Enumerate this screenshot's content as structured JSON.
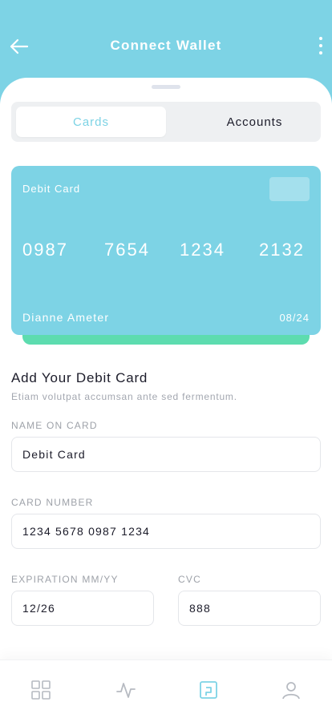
{
  "header": {
    "title": "Connect Wallet",
    "back_icon": "arrow-left-icon",
    "more_icon": "more-vertical-icon"
  },
  "segment": {
    "active_label": "Cards",
    "inactive_label": "Accounts"
  },
  "card": {
    "type_label": "Debit Card",
    "number_groups": [
      "0987",
      "7654",
      "1234",
      "2132"
    ],
    "holder": "Dianne Ameter",
    "expiry": "08/24"
  },
  "form": {
    "title": "Add Your Debit Card",
    "subtitle": "Etiam volutpat accumsan ante sed fermentum.",
    "name_label": "NAME ON CARD",
    "name_value": "Debit Card",
    "number_label": "CARD NUMBER",
    "number_value": "1234 5678 0987 1234",
    "expiry_label": "EXPIRATION MM/YY",
    "expiry_value": "12/26",
    "cvc_label": "CVC",
    "cvc_value": "888"
  },
  "tabbar": {
    "items": [
      "grid-icon",
      "activity-icon",
      "wallet-icon",
      "profile-icon"
    ],
    "active_index": 2
  },
  "colors": {
    "accent": "#7dd3e5",
    "card_bg": "#7dd3e5",
    "card_accent": "#5ddcaf",
    "text_dark": "#1c1c2a",
    "text_muted": "#a3a7b0"
  }
}
